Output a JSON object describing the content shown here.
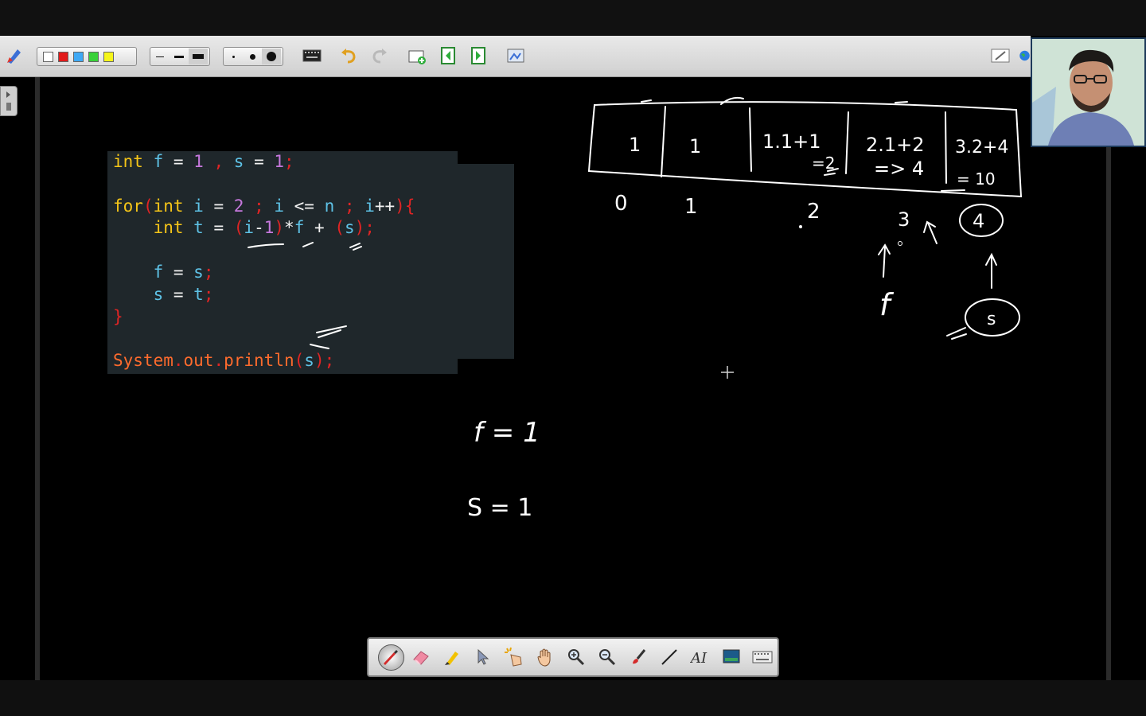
{
  "code": {
    "line1": {
      "t1": "int",
      "t2": " f ",
      "t3": "=",
      "t4": " 1 ",
      "t5": ",",
      "t6": " s ",
      "t7": "=",
      "t8": " 1",
      "t9": ";"
    },
    "line3": {
      "t1": "for",
      "t2": "(",
      "t3": "int",
      "t4": " i ",
      "t5": "=",
      "t6": " 2 ",
      "t7": ";",
      "t8": " i ",
      "t9": "<=",
      "t10": " n ",
      "t11": ";",
      "t12": " i",
      "t13": "++",
      "t14": "){"
    },
    "line4": {
      "t0": "    ",
      "t1": "int",
      "t2": " t ",
      "t3": "=",
      "t4": " ",
      "t5": "(",
      "t6": "i",
      "t7": "-",
      "t8": "1",
      "t9": ")",
      "t10": "*",
      "t11": "f",
      "t12": " ",
      "t13": "+",
      "t14": " ",
      "t15": "(",
      "t16": "s",
      "t17": ")",
      "t18": ";"
    },
    "line6": {
      "t0": "    ",
      "t1": "f",
      "t2": " = ",
      "t3": "s",
      "t4": ";"
    },
    "line7": {
      "t0": "    ",
      "t1": "s",
      "t2": " = ",
      "t3": "t",
      "t4": ";"
    },
    "line8": {
      "t1": "}"
    },
    "line10": {
      "t1": "System",
      "t2": ".",
      "t3": "out",
      "t4": ".",
      "t5": "println",
      "t6": "(",
      "t7": "s",
      "t8": ")",
      "t9": ";"
    }
  },
  "handwriting": {
    "cells": [
      "1",
      "1",
      "1.1+1",
      "=2",
      "2.1+2",
      "=> 4",
      "3.2+4",
      "= 10"
    ],
    "indices": [
      "0",
      "1",
      "2",
      "3",
      "4"
    ],
    "labels": {
      "f_label": "f",
      "s_label": "s"
    },
    "notes": [
      "f = 1",
      "S = 1"
    ]
  },
  "toolbar": {
    "colors": [
      "#ffffff",
      "#e21b1b",
      "#3fa9f5",
      "#39d139",
      "#f5f51a"
    ],
    "icons": [
      "pen-settings-icon",
      "line-thin-icon",
      "line-medium-icon",
      "line-thick-icon",
      "dot-small-icon",
      "dot-medium-icon",
      "dot-large-icon",
      "keyboard-icon",
      "undo-icon",
      "redo-icon",
      "new-page-icon",
      "prev-page-icon",
      "next-page-icon",
      "screenshot-icon",
      "whiteboard-icon",
      "globe-icon"
    ]
  },
  "bottom_tools": [
    "pen-icon",
    "eraser-icon",
    "highlighter-icon",
    "select-arrow-icon",
    "magic-pointer-icon",
    "hand-pan-icon",
    "zoom-in-icon",
    "zoom-out-icon",
    "brush-icon",
    "line-tool-icon",
    "text-tool-icon",
    "background-icon",
    "keyboard-icon"
  ]
}
